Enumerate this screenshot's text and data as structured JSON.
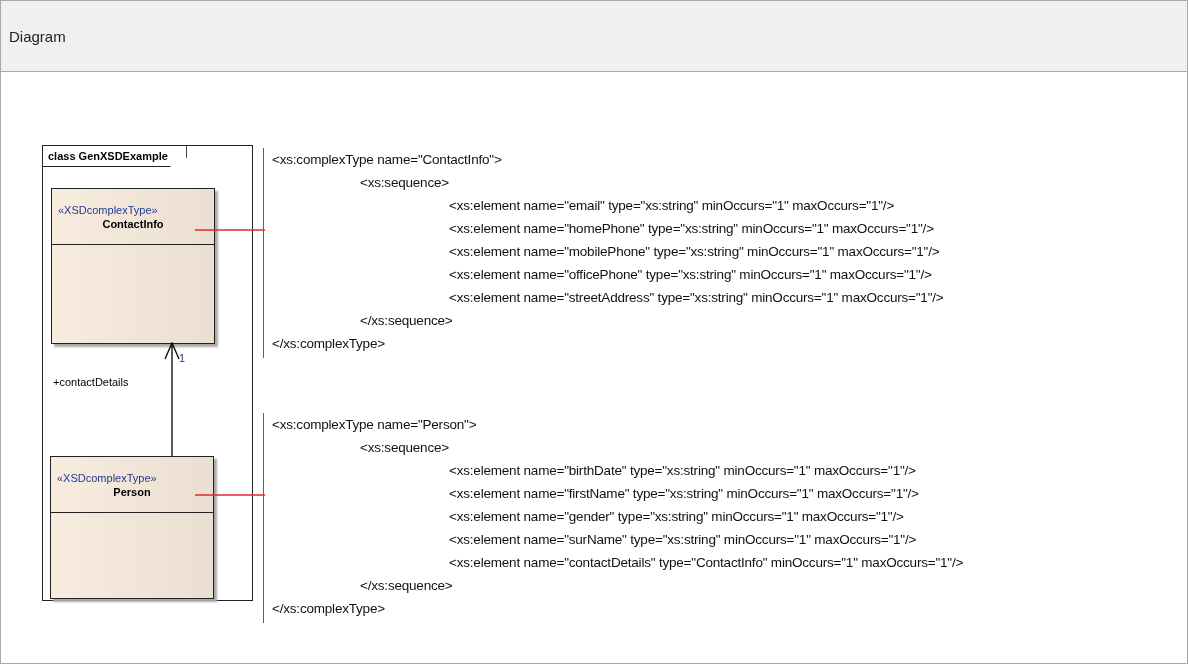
{
  "panel": {
    "title": "Diagram"
  },
  "diagram": {
    "frame_label": "class GenXSDExample",
    "classes": [
      {
        "stereotype": "«XSDcomplexType»",
        "name": "ContactInfo"
      },
      {
        "stereotype": "«XSDcomplexType»",
        "name": "Person"
      }
    ],
    "association": {
      "role": "+contactDetails",
      "multiplicity": "1"
    }
  },
  "code_blocks": [
    {
      "lines": [
        {
          "kind": "type",
          "text": "<xs:complexType name=\"ContactInfo\">"
        },
        {
          "kind": "sequence",
          "text": "<xs:sequence>"
        },
        {
          "kind": "element",
          "text": "<xs:element name=\"email\" type=\"xs:string\" minOccurs=\"1\" maxOccurs=\"1\"/>"
        },
        {
          "kind": "element",
          "text": "<xs:element name=\"homePhone\" type=\"xs:string\" minOccurs=\"1\" maxOccurs=\"1\"/>"
        },
        {
          "kind": "element",
          "text": "<xs:element name=\"mobilePhone\" type=\"xs:string\" minOccurs=\"1\" maxOccurs=\"1\"/>"
        },
        {
          "kind": "element",
          "text": "<xs:element name=\"officePhone\" type=\"xs:string\" minOccurs=\"1\" maxOccurs=\"1\"/>"
        },
        {
          "kind": "element",
          "text": "<xs:element name=\"streetAddress\" type=\"xs:string\" minOccurs=\"1\" maxOccurs=\"1\"/>"
        },
        {
          "kind": "sequence",
          "text": "</xs:sequence>"
        },
        {
          "kind": "type",
          "text": "</xs:complexType>"
        }
      ]
    },
    {
      "lines": [
        {
          "kind": "type",
          "text": "<xs:complexType name=\"Person\">"
        },
        {
          "kind": "sequence",
          "text": "<xs:sequence>"
        },
        {
          "kind": "element",
          "text": "<xs:element name=\"birthDate\" type=\"xs:string\" minOccurs=\"1\" maxOccurs=\"1\"/>"
        },
        {
          "kind": "element",
          "text": "<xs:element name=\"firstName\" type=\"xs:string\" minOccurs=\"1\" maxOccurs=\"1\"/>"
        },
        {
          "kind": "element",
          "text": "<xs:element name=\"gender\" type=\"xs:string\" minOccurs=\"1\" maxOccurs=\"1\"/>"
        },
        {
          "kind": "element",
          "text": "<xs:element name=\"surName\" type=\"xs:string\" minOccurs=\"1\" maxOccurs=\"1\"/>"
        },
        {
          "kind": "element",
          "text": "<xs:element name=\"contactDetails\" type=\"ContactInfo\" minOccurs=\"1\" maxOccurs=\"1\"/>"
        },
        {
          "kind": "sequence",
          "text": "</xs:sequence>"
        },
        {
          "kind": "type",
          "text": "</xs:complexType>"
        }
      ]
    }
  ]
}
